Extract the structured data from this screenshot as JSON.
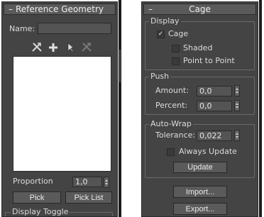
{
  "left_panel": {
    "rollout_collapse": "–",
    "title": "Reference Geometry",
    "name_label": "Name:",
    "name_value": "",
    "toolbar_icons": [
      "pick-tool-icon",
      "add-icon",
      "select-cursor-icon",
      "remove-tool-icon"
    ],
    "proportion_label": "Proportion",
    "proportion_value": "1,0",
    "pick_button": "Pick",
    "pick_list_button": "Pick List",
    "display_toggle_group": "Display Toggle"
  },
  "right_panel": {
    "rollout_collapse": "–",
    "title": "Cage",
    "display": {
      "group": "Display",
      "cage_label": "Cage",
      "cage_checked": true,
      "shaded_label": "Shaded",
      "shaded_checked": false,
      "point_to_point_label": "Point to Point",
      "point_to_point_checked": false
    },
    "push": {
      "group": "Push",
      "amount_label": "Amount:",
      "amount_value": "0,0",
      "percent_label": "Percent:",
      "percent_value": "0,0"
    },
    "auto_wrap": {
      "group": "Auto-Wrap",
      "tolerance_label": "Tolerance:",
      "tolerance_value": "0,022",
      "always_update_label": "Always Update",
      "always_update_checked": false,
      "update_button": "Update"
    },
    "import_button": "Import...",
    "export_button": "Export..."
  },
  "colors": {
    "panel_bg": "#444444",
    "rollout_header_bg": "#5a5a5a",
    "list_bg": "#ffffff",
    "text": "#dcdcdc"
  }
}
